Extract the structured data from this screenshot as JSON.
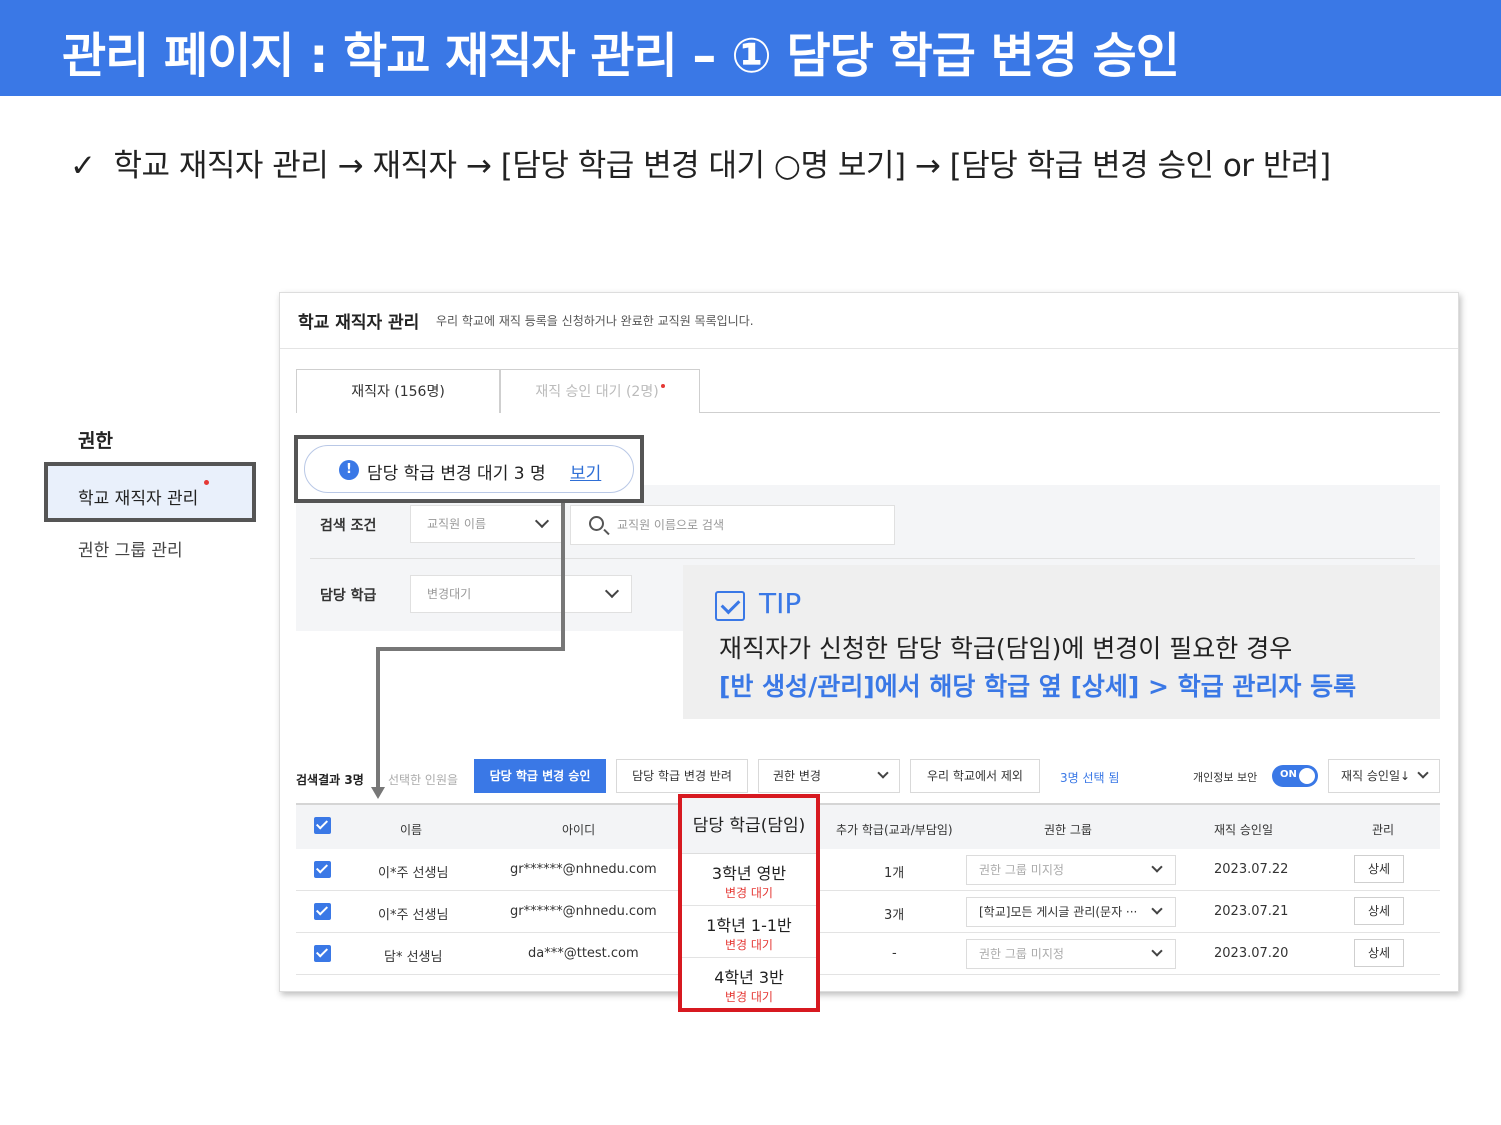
{
  "banner": {
    "title": "관리 페이지 : 학교 재직자 관리 – ① 담당 학급 변경 승인"
  },
  "path": {
    "check": "✓",
    "text": "학교 재직자 관리 → 재직자 → [담당 학급 변경 대기 ○명 보기] → [담당 학급 변경 승인 or 반려]"
  },
  "sidebar": {
    "heading": "권한",
    "items": [
      {
        "label": "학교 재직자 관리",
        "active": true
      },
      {
        "label": "권한 그룹 관리",
        "active": false
      }
    ]
  },
  "panel": {
    "title": "학교 재직자 관리",
    "description": "우리 학교에 재직 등록을 신청하거나 완료한 교직원 목록입니다.",
    "tabs": [
      {
        "label": "재직자 (156명)"
      },
      {
        "label": "재직 승인 대기 (2명)"
      }
    ],
    "pending": {
      "text": "담당 학급 변경 대기 3 명",
      "link": "보기",
      "icon": "info-icon"
    },
    "search": {
      "label": "검색 조건",
      "select_value": "교직원 이름",
      "input_placeholder": "교직원 이름으로 검색",
      "class_label": "담당 학급",
      "class_value": "변경대기"
    },
    "tip": {
      "label": "TIP",
      "line1": "재직자가 신청한 담당 학급(담임)에 변경이 필요한 경우",
      "line2": "[반 생성/관리]에서 해당 학급 옆 [상세] > 학급 관리자 등록"
    },
    "toolbar": {
      "result_count": "검색결과 3명",
      "selected_hint": "선택한 인원을",
      "approve": "담당 학급 변경 승인",
      "reject": "담당 학급 변경 반려",
      "permission_change": "권한 변경",
      "exclude": "우리 학교에서 제외",
      "selected_count": "3명 선택 됨",
      "privacy_label": "개인정보 보안",
      "toggle": "ON",
      "sort": "재직 승인일↓"
    },
    "table": {
      "headers": [
        "이름",
        "아이디",
        "담당 학급(담임)",
        "추가 학급(교과/부담임)",
        "권한 그룹",
        "재직 승인일",
        "관리"
      ],
      "rows": [
        {
          "name": "이*주 선생님",
          "id": "gr******@nhnedu.com",
          "class": "3학년 영반",
          "class_status": "변경 대기",
          "extra": "1개",
          "group": "권한 그룹 미지정",
          "group_set": false,
          "date": "2023.07.22",
          "action": "상세"
        },
        {
          "name": "이*주 선생님",
          "id": "gr******@nhnedu.com",
          "class": "1학년 1-1반",
          "class_status": "변경 대기",
          "extra": "3개",
          "group": "[학교]모든 게시글 관리(문자 ···",
          "group_set": true,
          "date": "2023.07.21",
          "action": "상세"
        },
        {
          "name": "담* 선생님",
          "id": "da***@ttest.com",
          "class": "4학년 3반",
          "class_status": "변경 대기",
          "extra": "-",
          "group": "권한 그룹 미지정",
          "group_set": false,
          "date": "2023.07.20",
          "action": "상세"
        }
      ]
    }
  },
  "colors": {
    "accent": "#3a78e6",
    "highlight": "#d71920",
    "status": "#e53935"
  }
}
